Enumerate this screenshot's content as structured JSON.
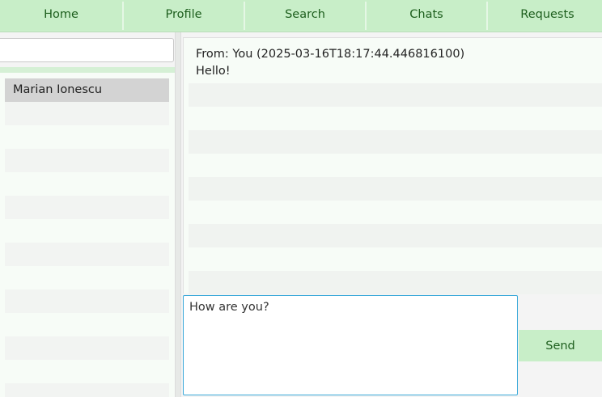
{
  "nav": {
    "tabs": [
      {
        "label": "Home"
      },
      {
        "label": "Profile"
      },
      {
        "label": "Search"
      },
      {
        "label": "Chats"
      },
      {
        "label": "Requests"
      }
    ]
  },
  "sidebar": {
    "search_value": "",
    "users": [
      {
        "name": "Marian Ionescu",
        "selected": true
      }
    ]
  },
  "chat": {
    "messages": [
      {
        "header": "From: You (2025-03-16T18:17:44.446816100)",
        "text": "Hello!"
      }
    ]
  },
  "composer": {
    "value": "How are you?",
    "send_label": "Send"
  },
  "colors": {
    "accent_green": "#c8eec8",
    "accent_text": "#1d5e1d",
    "focus_blue": "#3aa9d9",
    "selected_row": "#d3d3d3"
  }
}
